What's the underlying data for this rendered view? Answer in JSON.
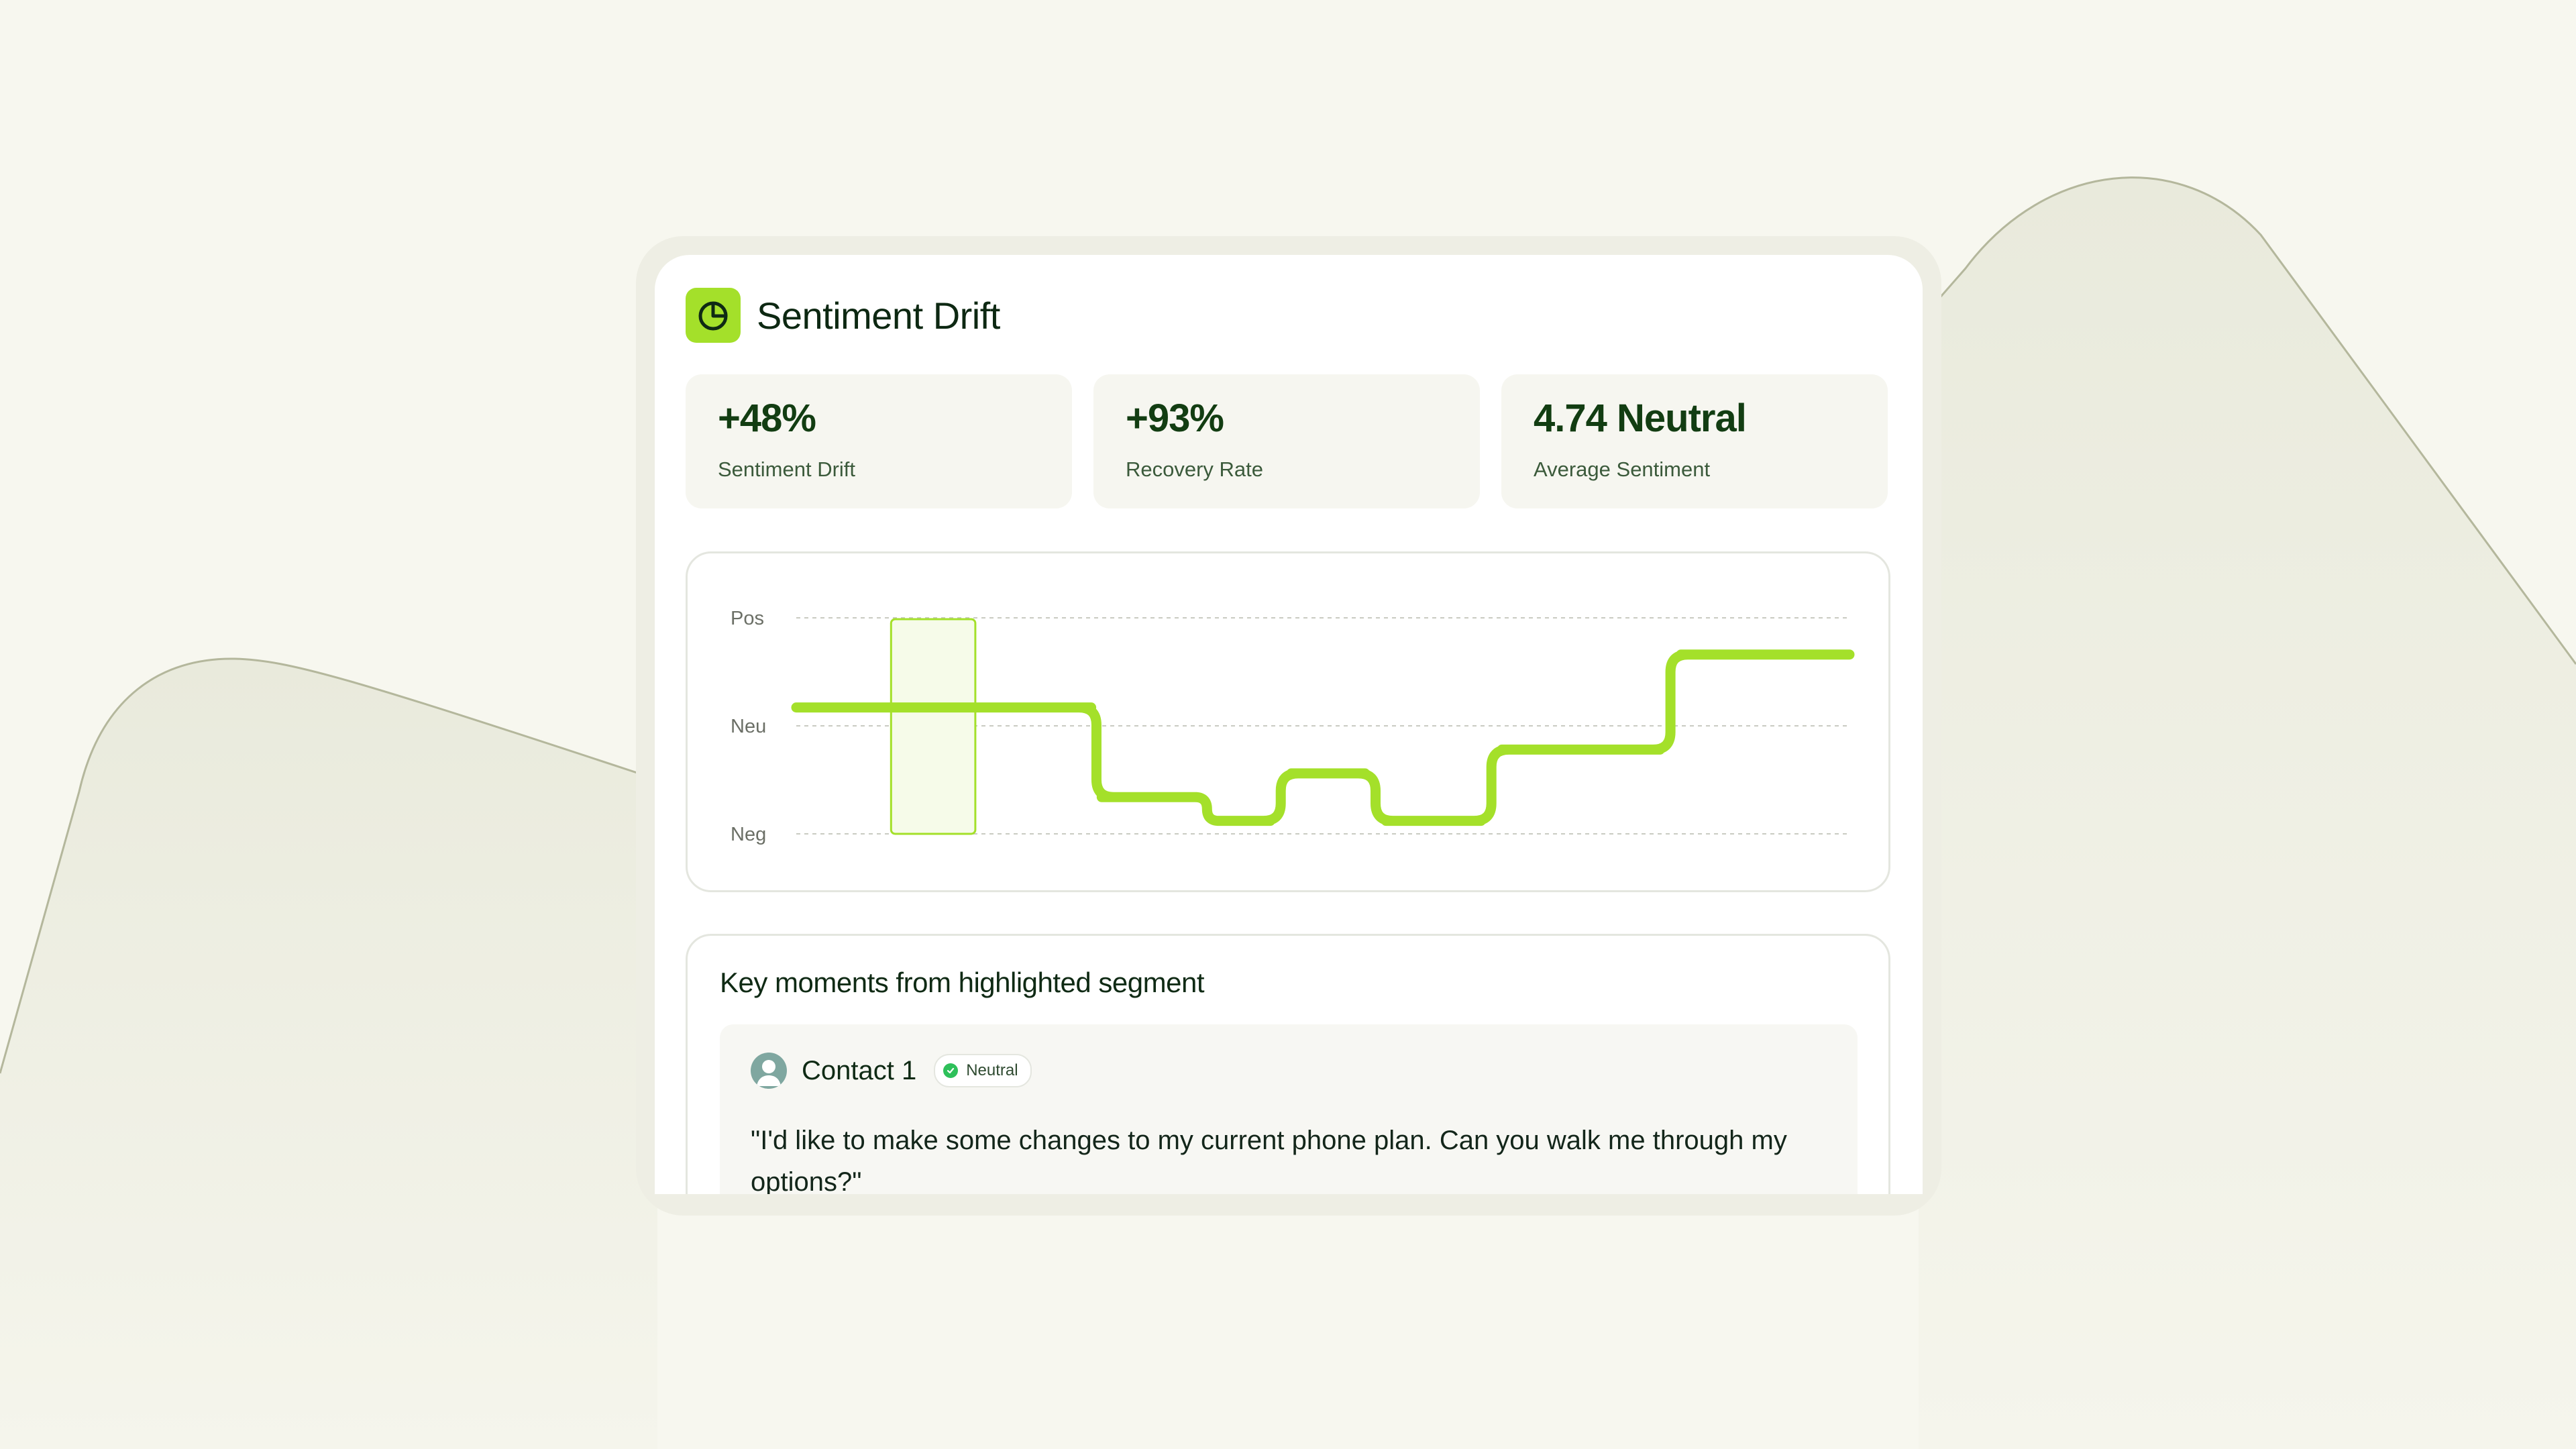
{
  "header": {
    "title": "Sentiment Drift",
    "icon": "pie-chart-icon"
  },
  "stats": [
    {
      "value": "+48%",
      "label": "Sentiment Drift"
    },
    {
      "value": "+93%",
      "label": "Recovery Rate"
    },
    {
      "value": "4.74 Neutral",
      "label": "Average Sentiment"
    }
  ],
  "chart_data": {
    "type": "line",
    "y_categories": [
      "Pos",
      "Neu",
      "Neg"
    ],
    "series": [
      {
        "color": "#a4e02a",
        "x": [
          0,
          10,
          20,
          28,
          29,
          38,
          40,
          45,
          47,
          54,
          56,
          65,
          67,
          82,
          84,
          100
        ],
        "y": [
          0.17,
          0.17,
          0.17,
          0.17,
          -0.66,
          -0.66,
          -0.88,
          -0.88,
          -0.44,
          -0.44,
          -0.88,
          -0.88,
          -0.22,
          -0.22,
          0.66,
          0.66
        ]
      }
    ],
    "highlight": {
      "x_start": 9,
      "x_end": 17
    },
    "grid": true,
    "accent": "#a4e02a"
  },
  "moments": {
    "title": "Key moments from highlighted segment",
    "contact": {
      "name": "Contact 1",
      "badge": "Neutral",
      "quote": "\"I'd like to make some changes to my current phone plan. Can you walk me through my options?\""
    }
  }
}
